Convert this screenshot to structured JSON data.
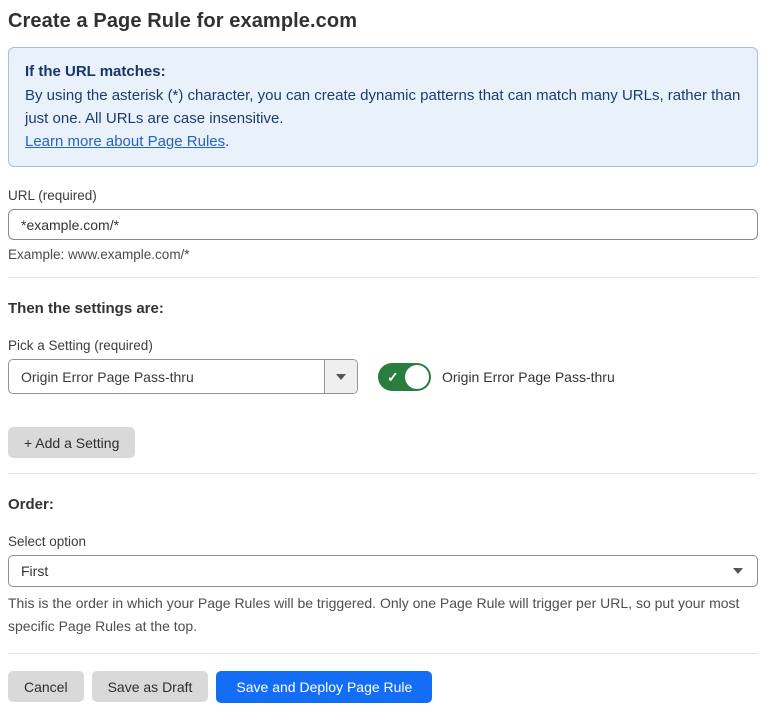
{
  "page": {
    "title": "Create a Page Rule for example.com"
  },
  "info_box": {
    "heading": "If the URL matches:",
    "body": "By using the asterisk (*) character, you can create dynamic patterns that can match many URLs, rather than just one. All URLs are case insensitive.",
    "link": "Learn more about Page Rules",
    "link_suffix": "."
  },
  "url_field": {
    "label": "URL (required)",
    "value": "*example.com/*",
    "helper": "Example: www.example.com/*"
  },
  "settings_section": {
    "heading": "Then the settings are:",
    "picker_label": "Pick a Setting (required)",
    "picker_value": "Origin Error Page Pass-thru",
    "toggle": {
      "state": "on",
      "label": "Origin Error Page Pass-thru"
    },
    "add_button": "+ Add a Setting"
  },
  "order_section": {
    "heading": "Order:",
    "label": "Select option",
    "value": "First",
    "helper": "This is the order in which your Page Rules will be triggered. Only one Page Rule will trigger per URL, so put your most specific Page Rules at the top."
  },
  "footer": {
    "cancel": "Cancel",
    "save_draft": "Save as Draft",
    "save_deploy": "Save and Deploy Page Rule"
  },
  "icons": {
    "check": "✓",
    "caret_down": "caret-down"
  },
  "colors": {
    "accent_blue": "#146ef5",
    "toggle_green": "#2a7c3f",
    "info_bg": "#e9f1fa",
    "info_border": "#9fc2e6",
    "info_text": "#1c3d6e",
    "link_blue": "#2563c9",
    "button_gray": "#d9d9d9",
    "divider_gray": "#e3e3e3"
  }
}
